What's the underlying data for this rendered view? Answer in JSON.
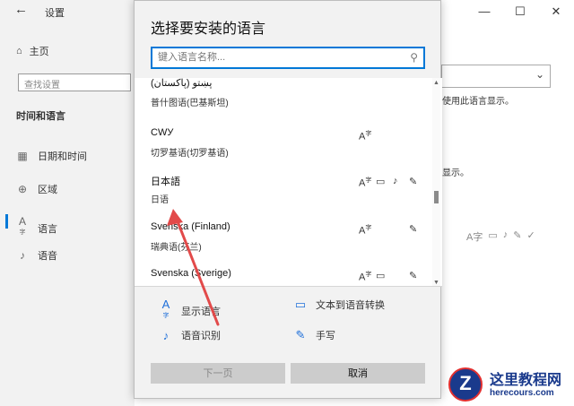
{
  "settings": {
    "title": "设置",
    "home_label": "主页",
    "search_placeholder": "查找设置",
    "section": "时间和语言",
    "nav": [
      {
        "label": "日期和时间",
        "icon": "calendar-icon"
      },
      {
        "label": "区域",
        "icon": "globe-icon"
      },
      {
        "label": "语言",
        "icon": "language-icon"
      },
      {
        "label": "语音",
        "icon": "microphone-icon"
      }
    ],
    "right_text1": "使用此语言显示。",
    "right_text2": "显示。"
  },
  "dialog": {
    "title": "选择要安装的语言",
    "search_placeholder": "键入语言名称...",
    "languages": [
      {
        "native": "پښتو (پاکستان)",
        "local": "普什图语(巴基斯坦)",
        "caps": []
      },
      {
        "native": "СWУ",
        "local": "切罗基语(切罗基语)",
        "caps": [
          "display"
        ]
      },
      {
        "native": "日本語",
        "local": "日语",
        "caps": [
          "display",
          "tts",
          "speech",
          "handwriting"
        ]
      },
      {
        "native": "Svenska (Finland)",
        "local": "瑞典语(芬兰)",
        "caps": [
          "display",
          "handwriting"
        ]
      },
      {
        "native": "Svenska (Sverige)",
        "local": "",
        "caps": [
          "display",
          "tts",
          "handwriting"
        ]
      }
    ],
    "legend": {
      "display": "显示语言",
      "tts": "文本到语音转换",
      "speech": "语音识别",
      "handwriting": "手写"
    },
    "next_button": "下一页",
    "cancel_button": "取消"
  },
  "watermark": {
    "name": "这里教程网",
    "url": "herecours.com"
  },
  "colors": {
    "accent": "#0078d7",
    "arrow": "#e24a4a",
    "watermark_blue": "#1a3a8c"
  }
}
